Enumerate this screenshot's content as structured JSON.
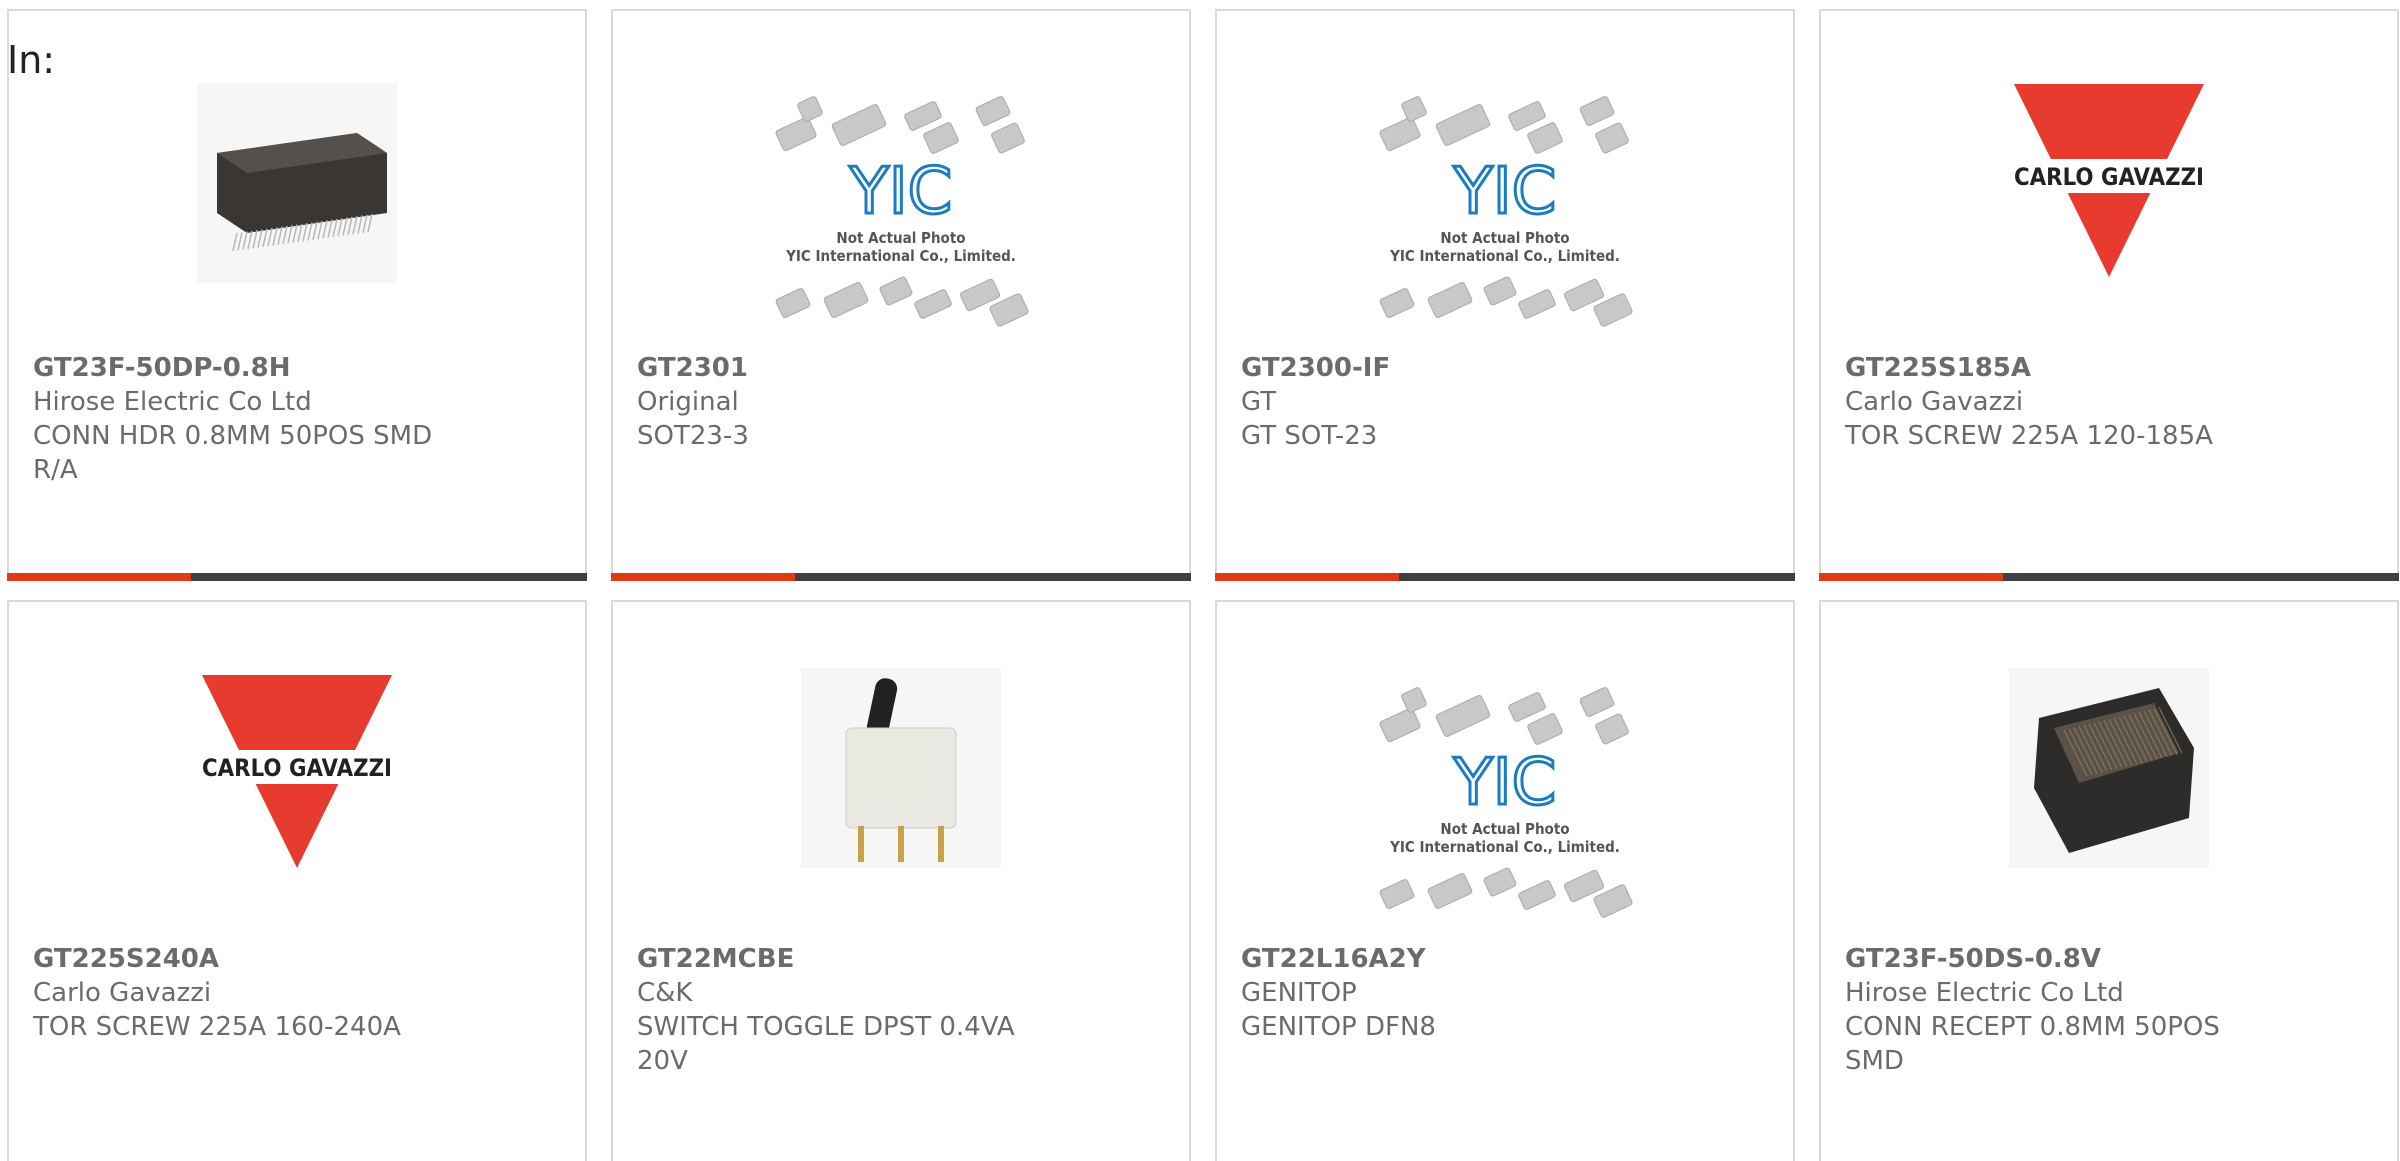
{
  "filter_label": "In:",
  "brand_colors": {
    "accent": "#e03a14",
    "bar": "#404040",
    "card_border": "#d9d9d9",
    "text": "#6b6b6b"
  },
  "placeholder_text": {
    "line1": "Not Actual Photo",
    "line2": "YIC International Co., Limited.",
    "logo": "YIC"
  },
  "carlo_logo_text": "CARLO GAVAZZI",
  "products": [
    {
      "part_number": "GT23F-50DP-0.8H",
      "manufacturer": "Hirose Electric Co Ltd",
      "description": "CONN HDR 0.8MM 50POS SMD R/A",
      "image": "connector-header-photo"
    },
    {
      "part_number": "GT2301",
      "manufacturer": "Original",
      "description": "SOT23-3",
      "image": "not-actual-photo-placeholder"
    },
    {
      "part_number": "GT2300-IF",
      "manufacturer": "GT",
      "description": "GT SOT-23",
      "image": "not-actual-photo-placeholder"
    },
    {
      "part_number": "GT225S185A",
      "manufacturer": "Carlo Gavazzi",
      "description": "TOR SCREW 225A 120-185A",
      "image": "carlo-gavazzi-logo"
    },
    {
      "part_number": "GT225S240A",
      "manufacturer": "Carlo Gavazzi",
      "description": "TOR SCREW 225A 160-240A",
      "image": "carlo-gavazzi-logo"
    },
    {
      "part_number": "GT22MCBE",
      "manufacturer": "C&K",
      "description": "SWITCH TOGGLE DPST 0.4VA 20V",
      "image": "toggle-switch-photo"
    },
    {
      "part_number": "GT22L16A2Y",
      "manufacturer": "GENITOP",
      "description": "GENITOP DFN8",
      "image": "not-actual-photo-placeholder"
    },
    {
      "part_number": "GT23F-50DS-0.8V",
      "manufacturer": "Hirose Electric Co Ltd",
      "description": "CONN RECEPT 0.8MM 50POS SMD",
      "image": "connector-receptacle-photo"
    }
  ]
}
